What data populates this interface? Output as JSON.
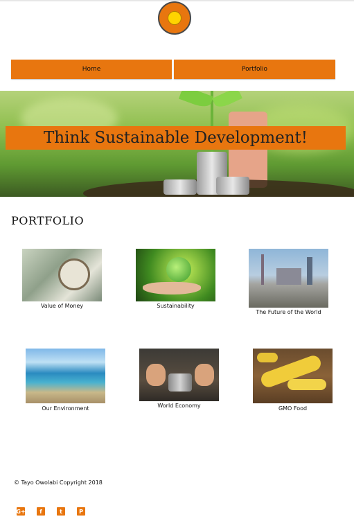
{
  "nav": {
    "home_label": "Home",
    "portfolio_label": "Portfolio"
  },
  "hero": {
    "banner_text": "Think Sustainable Development!"
  },
  "portfolio": {
    "title": "PORTFOLIO",
    "items": [
      {
        "caption": "Value of Money"
      },
      {
        "caption": "Sustainability"
      },
      {
        "caption": "The Future of the World"
      },
      {
        "caption": "Our Environment"
      },
      {
        "caption": "World Economy"
      },
      {
        "caption": "GMO Food"
      }
    ]
  },
  "footer": {
    "copyright": "© Tayo Owolabi Copyright 2018"
  },
  "social": {
    "icons": [
      {
        "name": "google-plus-icon",
        "glyph": "G+"
      },
      {
        "name": "facebook-icon",
        "glyph": "f"
      },
      {
        "name": "twitter-icon",
        "glyph": "t"
      },
      {
        "name": "pinterest-icon",
        "glyph": "P"
      }
    ]
  },
  "colors": {
    "accent": "#e8760f",
    "logo_inner": "#ffd400"
  }
}
